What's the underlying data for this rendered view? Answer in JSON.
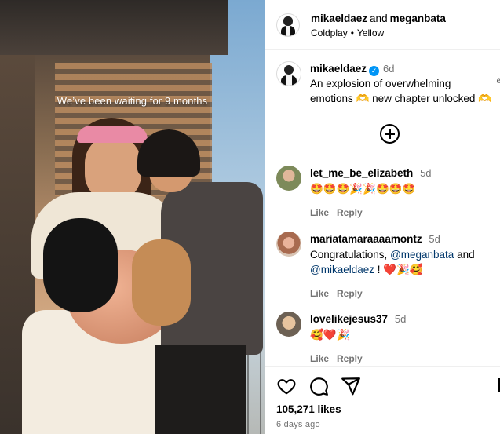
{
  "media": {
    "overlay_text": "We’ve been waiting for 9 months"
  },
  "header": {
    "user1": "mikaeldaez",
    "conjunction": "and",
    "user2": "meganbata",
    "artist": "Coldplay",
    "separator": "•",
    "song": "Yellow"
  },
  "caption": {
    "user": "mikaeldaez",
    "verified_icon": "check-icon",
    "time": "6d",
    "text": "An explosion of overwhelming emotions 🫶 new chapter unlocked 🫶",
    "edge_glyph": "e"
  },
  "comments": [
    {
      "user": "let_me_be_elizabeth",
      "time": "5d",
      "text": "🤩🤩🤩🎉🎉🤩🤩🤩",
      "like": "Like",
      "reply": "Reply"
    },
    {
      "user": "mariatamaraaaamontz",
      "time": "5d",
      "text_before": "Congratulations, ",
      "mention1": "@meganbata",
      "text_mid": " and ",
      "mention2": "@mikaeldaez",
      "text_after": " ! ❤️🎉🥰",
      "like": "Like",
      "reply": "Reply"
    },
    {
      "user": "lovelikejesus37",
      "time": "5d",
      "text": "🥰❤️🎉",
      "like": "Like",
      "reply": "Reply"
    }
  ],
  "footer": {
    "likes": "105,271 likes",
    "date": "6 days ago"
  },
  "icons": {
    "like": "heart-icon",
    "comment": "comment-icon",
    "share": "send-icon",
    "add": "plus-circle-icon"
  }
}
